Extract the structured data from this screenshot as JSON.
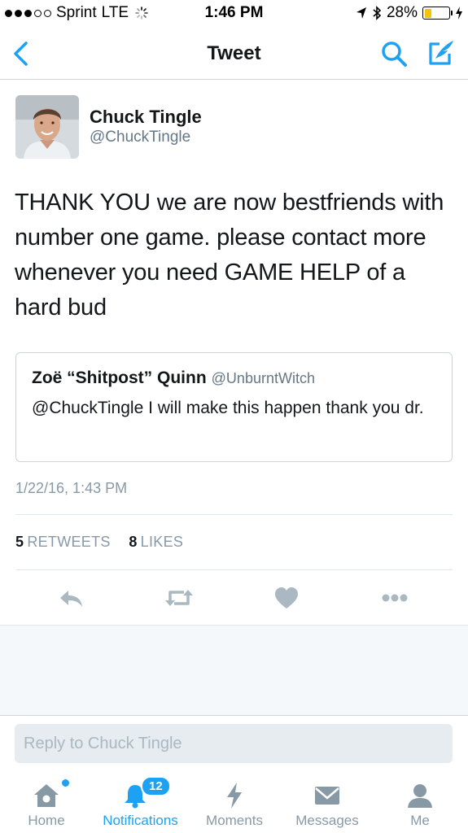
{
  "status_bar": {
    "carrier": "Sprint",
    "network": "LTE",
    "time": "1:46 PM",
    "battery_percent": "28%",
    "battery_level": 0.28,
    "battery_color": "#f5c400"
  },
  "nav": {
    "title": "Tweet",
    "back_icon": "chevron-left-icon",
    "search_icon": "search-icon",
    "compose_icon": "compose-tweet-icon"
  },
  "tweet": {
    "author_name": "Chuck Tingle",
    "author_handle": "@ChuckTingle",
    "text": "THANK YOU we are now bestfriends with number one game. please contact more whenever you need GAME HELP of a hard bud",
    "timestamp": "1/22/16, 1:43 PM",
    "retweets_count": "5",
    "retweets_label": "RETWEETS",
    "likes_count": "8",
    "likes_label": "LIKES"
  },
  "quoted_tweet": {
    "name": "Zoë “Shitpost” Quinn",
    "handle": "@UnburntWitch",
    "text": "@ChuckTingle I will make this happen thank you dr."
  },
  "actions": [
    "reply-icon",
    "retweet-icon",
    "like-icon",
    "more-icon"
  ],
  "reply": {
    "placeholder": "Reply to Chuck Tingle"
  },
  "tabs": [
    {
      "label": "Home",
      "icon": "home-icon",
      "active": false
    },
    {
      "label": "Notifications",
      "icon": "notifications-icon",
      "active": true,
      "badge": "12"
    },
    {
      "label": "Moments",
      "icon": "moments-icon",
      "active": false
    },
    {
      "label": "Messages",
      "icon": "messages-icon",
      "active": false
    },
    {
      "label": "Me",
      "icon": "me-icon",
      "active": false
    }
  ],
  "colors": {
    "accent": "#1da1f2",
    "muted": "#8899a6",
    "text": "#14171a"
  }
}
